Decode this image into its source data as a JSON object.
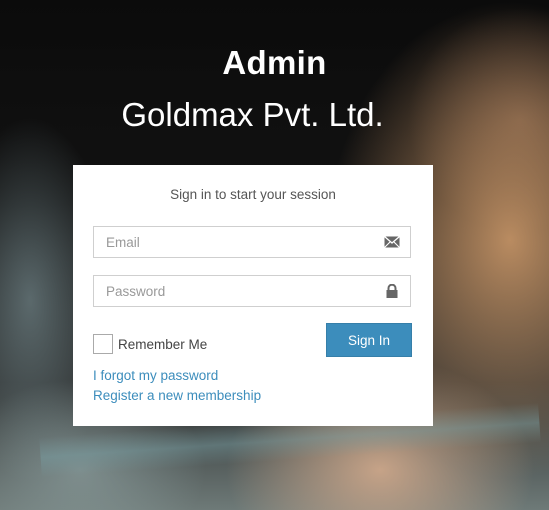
{
  "header": {
    "title": "Admin",
    "subtitle": "Goldmax Pvt. Ltd."
  },
  "login": {
    "message": "Sign in to start your session",
    "email": {
      "placeholder": "Email",
      "value": "",
      "icon": "envelope-icon"
    },
    "password": {
      "placeholder": "Password",
      "value": "",
      "icon": "lock-icon"
    },
    "remember_label": "Remember Me",
    "remember_checked": false,
    "signin_label": "Sign In",
    "forgot_link": "I forgot my password",
    "register_link": "Register a new membership"
  },
  "colors": {
    "accent": "#3c8dbc",
    "card_bg": "#ffffff",
    "title_text": "#ffffff"
  }
}
